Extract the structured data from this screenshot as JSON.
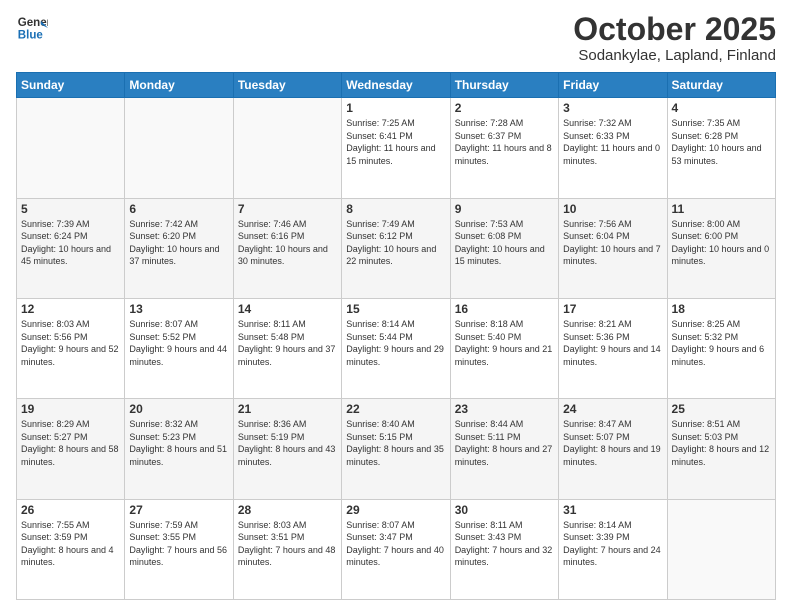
{
  "header": {
    "logo_line1": "General",
    "logo_line2": "Blue",
    "month": "October 2025",
    "location": "Sodankylae, Lapland, Finland"
  },
  "days_of_week": [
    "Sunday",
    "Monday",
    "Tuesday",
    "Wednesday",
    "Thursday",
    "Friday",
    "Saturday"
  ],
  "weeks": [
    [
      {
        "day": "",
        "info": ""
      },
      {
        "day": "",
        "info": ""
      },
      {
        "day": "",
        "info": ""
      },
      {
        "day": "1",
        "info": "Sunrise: 7:25 AM\nSunset: 6:41 PM\nDaylight: 11 hours\nand 15 minutes."
      },
      {
        "day": "2",
        "info": "Sunrise: 7:28 AM\nSunset: 6:37 PM\nDaylight: 11 hours\nand 8 minutes."
      },
      {
        "day": "3",
        "info": "Sunrise: 7:32 AM\nSunset: 6:33 PM\nDaylight: 11 hours\nand 0 minutes."
      },
      {
        "day": "4",
        "info": "Sunrise: 7:35 AM\nSunset: 6:28 PM\nDaylight: 10 hours\nand 53 minutes."
      }
    ],
    [
      {
        "day": "5",
        "info": "Sunrise: 7:39 AM\nSunset: 6:24 PM\nDaylight: 10 hours\nand 45 minutes."
      },
      {
        "day": "6",
        "info": "Sunrise: 7:42 AM\nSunset: 6:20 PM\nDaylight: 10 hours\nand 37 minutes."
      },
      {
        "day": "7",
        "info": "Sunrise: 7:46 AM\nSunset: 6:16 PM\nDaylight: 10 hours\nand 30 minutes."
      },
      {
        "day": "8",
        "info": "Sunrise: 7:49 AM\nSunset: 6:12 PM\nDaylight: 10 hours\nand 22 minutes."
      },
      {
        "day": "9",
        "info": "Sunrise: 7:53 AM\nSunset: 6:08 PM\nDaylight: 10 hours\nand 15 minutes."
      },
      {
        "day": "10",
        "info": "Sunrise: 7:56 AM\nSunset: 6:04 PM\nDaylight: 10 hours\nand 7 minutes."
      },
      {
        "day": "11",
        "info": "Sunrise: 8:00 AM\nSunset: 6:00 PM\nDaylight: 10 hours\nand 0 minutes."
      }
    ],
    [
      {
        "day": "12",
        "info": "Sunrise: 8:03 AM\nSunset: 5:56 PM\nDaylight: 9 hours\nand 52 minutes."
      },
      {
        "day": "13",
        "info": "Sunrise: 8:07 AM\nSunset: 5:52 PM\nDaylight: 9 hours\nand 44 minutes."
      },
      {
        "day": "14",
        "info": "Sunrise: 8:11 AM\nSunset: 5:48 PM\nDaylight: 9 hours\nand 37 minutes."
      },
      {
        "day": "15",
        "info": "Sunrise: 8:14 AM\nSunset: 5:44 PM\nDaylight: 9 hours\nand 29 minutes."
      },
      {
        "day": "16",
        "info": "Sunrise: 8:18 AM\nSunset: 5:40 PM\nDaylight: 9 hours\nand 21 minutes."
      },
      {
        "day": "17",
        "info": "Sunrise: 8:21 AM\nSunset: 5:36 PM\nDaylight: 9 hours\nand 14 minutes."
      },
      {
        "day": "18",
        "info": "Sunrise: 8:25 AM\nSunset: 5:32 PM\nDaylight: 9 hours\nand 6 minutes."
      }
    ],
    [
      {
        "day": "19",
        "info": "Sunrise: 8:29 AM\nSunset: 5:27 PM\nDaylight: 8 hours\nand 58 minutes."
      },
      {
        "day": "20",
        "info": "Sunrise: 8:32 AM\nSunset: 5:23 PM\nDaylight: 8 hours\nand 51 minutes."
      },
      {
        "day": "21",
        "info": "Sunrise: 8:36 AM\nSunset: 5:19 PM\nDaylight: 8 hours\nand 43 minutes."
      },
      {
        "day": "22",
        "info": "Sunrise: 8:40 AM\nSunset: 5:15 PM\nDaylight: 8 hours\nand 35 minutes."
      },
      {
        "day": "23",
        "info": "Sunrise: 8:44 AM\nSunset: 5:11 PM\nDaylight: 8 hours\nand 27 minutes."
      },
      {
        "day": "24",
        "info": "Sunrise: 8:47 AM\nSunset: 5:07 PM\nDaylight: 8 hours\nand 19 minutes."
      },
      {
        "day": "25",
        "info": "Sunrise: 8:51 AM\nSunset: 5:03 PM\nDaylight: 8 hours\nand 12 minutes."
      }
    ],
    [
      {
        "day": "26",
        "info": "Sunrise: 7:55 AM\nSunset: 3:59 PM\nDaylight: 8 hours\nand 4 minutes."
      },
      {
        "day": "27",
        "info": "Sunrise: 7:59 AM\nSunset: 3:55 PM\nDaylight: 7 hours\nand 56 minutes."
      },
      {
        "day": "28",
        "info": "Sunrise: 8:03 AM\nSunset: 3:51 PM\nDaylight: 7 hours\nand 48 minutes."
      },
      {
        "day": "29",
        "info": "Sunrise: 8:07 AM\nSunset: 3:47 PM\nDaylight: 7 hours\nand 40 minutes."
      },
      {
        "day": "30",
        "info": "Sunrise: 8:11 AM\nSunset: 3:43 PM\nDaylight: 7 hours\nand 32 minutes."
      },
      {
        "day": "31",
        "info": "Sunrise: 8:14 AM\nSunset: 3:39 PM\nDaylight: 7 hours\nand 24 minutes."
      },
      {
        "day": "",
        "info": ""
      }
    ]
  ]
}
